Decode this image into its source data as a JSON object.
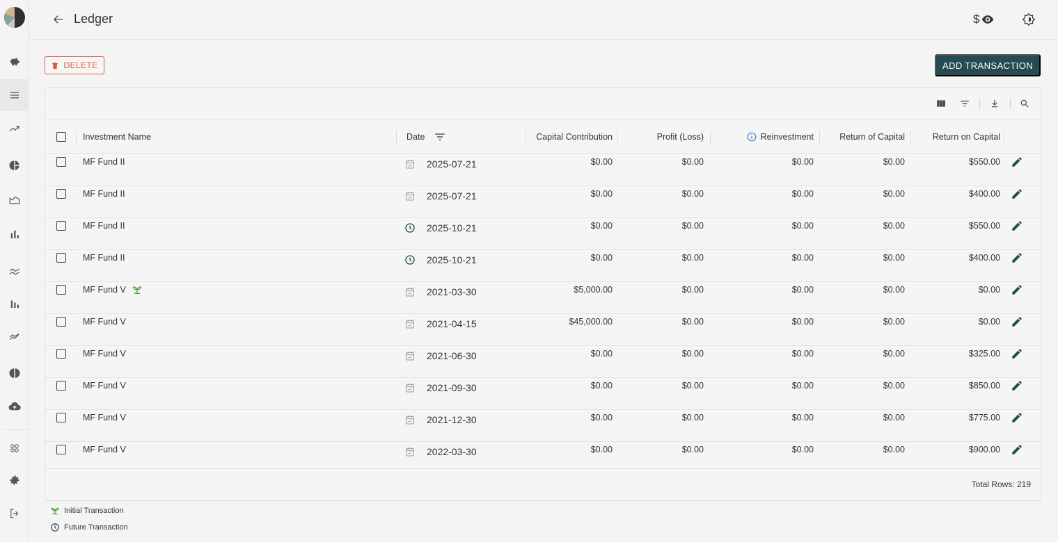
{
  "header": {
    "title": "Ledger",
    "currency_symbol": "$"
  },
  "actions": {
    "delete_label": "DELETE",
    "add_label": "ADD TRANSACTION"
  },
  "columns": {
    "name": "Investment Name",
    "date": "Date",
    "capital": "Capital Contribution",
    "profit": "Profit (Loss)",
    "reinvest": "Reinvestment",
    "return_capital": "Return of Capital",
    "return_on": "Return on Capital"
  },
  "rows": [
    {
      "name": "MF Fund II",
      "icon": "calendar-check-icon",
      "date": "2025-07-21",
      "capital": "$0.00",
      "profit": "$0.00",
      "reinvest": "$0.00",
      "roc": "$0.00",
      "ron": "$550.00"
    },
    {
      "name": "MF Fund II",
      "icon": "calendar-check-icon",
      "date": "2025-07-21",
      "capital": "$0.00",
      "profit": "$0.00",
      "reinvest": "$0.00",
      "roc": "$0.00",
      "ron": "$400.00"
    },
    {
      "name": "MF Fund II",
      "icon": "clock-icon",
      "date": "2025-10-21",
      "capital": "$0.00",
      "profit": "$0.00",
      "reinvest": "$0.00",
      "roc": "$0.00",
      "ron": "$550.00"
    },
    {
      "name": "MF Fund II",
      "icon": "clock-icon",
      "date": "2025-10-21",
      "capital": "$0.00",
      "profit": "$0.00",
      "reinvest": "$0.00",
      "roc": "$0.00",
      "ron": "$400.00"
    },
    {
      "name": "MF Fund V",
      "initial": true,
      "icon": "calendar-check-icon",
      "date": "2021-03-30",
      "capital": "$5,000.00",
      "profit": "$0.00",
      "reinvest": "$0.00",
      "roc": "$0.00",
      "ron": "$0.00"
    },
    {
      "name": "MF Fund V",
      "icon": "calendar-check-icon",
      "date": "2021-04-15",
      "capital": "$45,000.00",
      "profit": "$0.00",
      "reinvest": "$0.00",
      "roc": "$0.00",
      "ron": "$0.00"
    },
    {
      "name": "MF Fund V",
      "icon": "calendar-check-icon",
      "date": "2021-06-30",
      "capital": "$0.00",
      "profit": "$0.00",
      "reinvest": "$0.00",
      "roc": "$0.00",
      "ron": "$325.00"
    },
    {
      "name": "MF Fund V",
      "icon": "calendar-check-icon",
      "date": "2021-09-30",
      "capital": "$0.00",
      "profit": "$0.00",
      "reinvest": "$0.00",
      "roc": "$0.00",
      "ron": "$850.00"
    },
    {
      "name": "MF Fund V",
      "icon": "calendar-check-icon",
      "date": "2021-12-30",
      "capital": "$0.00",
      "profit": "$0.00",
      "reinvest": "$0.00",
      "roc": "$0.00",
      "ron": "$775.00"
    },
    {
      "name": "MF Fund V",
      "icon": "calendar-check-icon",
      "date": "2022-03-30",
      "capital": "$0.00",
      "profit": "$0.00",
      "reinvest": "$0.00",
      "roc": "$0.00",
      "ron": "$900.00"
    }
  ],
  "footer": {
    "total_rows": "Total Rows: 219"
  },
  "legend": {
    "initial": "Initial Transaction",
    "future": "Future Transaction"
  },
  "colors": {
    "accent": "#264b52",
    "delete": "#e05a38",
    "initial_icon": "#4c9a3c",
    "info": "#2f7fd1"
  }
}
